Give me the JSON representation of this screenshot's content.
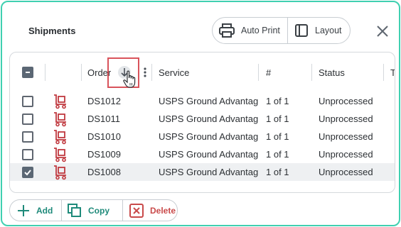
{
  "dialog": {
    "title": "Shipments"
  },
  "toolbar": {
    "auto_print_label": "Auto Print",
    "layout_label": "Layout"
  },
  "grid": {
    "columns": [
      "Order",
      "Service",
      "#",
      "Status",
      "T"
    ],
    "rows": [
      {
        "order": "DS1012",
        "service": "USPS Ground Advantage",
        "count": "1 of 1",
        "status": "Unprocessed",
        "selected": false
      },
      {
        "order": "DS1011",
        "service": "USPS Ground Advantage",
        "count": "1 of 1",
        "status": "Unprocessed",
        "selected": false
      },
      {
        "order": "DS1010",
        "service": "USPS Ground Advantage",
        "count": "1 of 1",
        "status": "Unprocessed",
        "selected": false
      },
      {
        "order": "DS1009",
        "service": "USPS Ground Advantage",
        "count": "1 of 1",
        "status": "Unprocessed",
        "selected": false
      },
      {
        "order": "DS1008",
        "service": "USPS Ground Advantage",
        "count": "1 of 1",
        "status": "Unprocessed",
        "selected": true
      }
    ]
  },
  "actions": {
    "add_label": "Add",
    "copy_label": "Copy",
    "delete_label": "Delete"
  },
  "colors": {
    "accent": "#1e8a7a",
    "danger": "#c94a4a",
    "frame": "#3fd0b0"
  },
  "icons": {
    "shipment_row": "hand-truck-icon"
  }
}
